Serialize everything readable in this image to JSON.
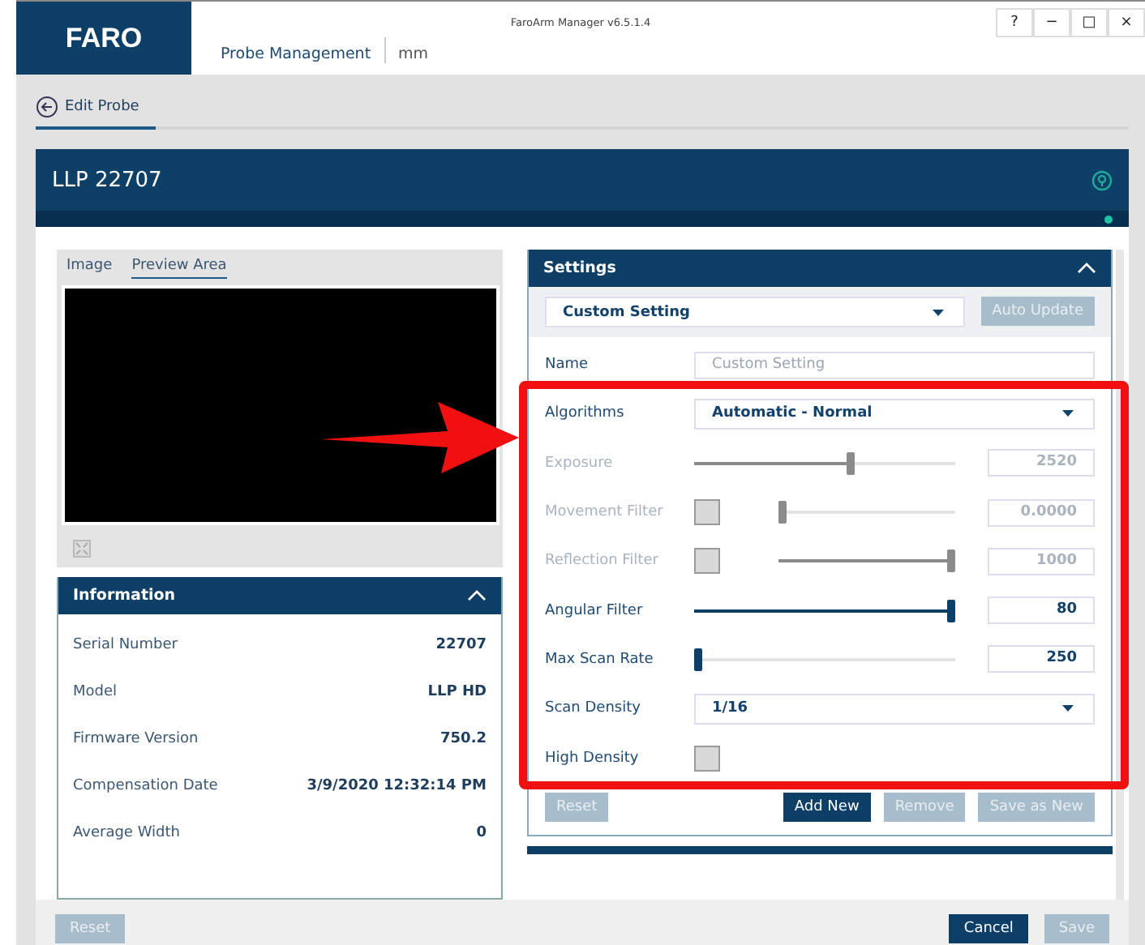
{
  "window": {
    "logo": "FARO",
    "title": "FaroArm Manager v6.5.1.4",
    "nav": "Probe Management",
    "units": "mm",
    "controls": [
      "?",
      "−",
      "□",
      "×"
    ]
  },
  "page_tab": {
    "label": "Edit Probe",
    "selected": true
  },
  "probe": {
    "name": "LLP 22707"
  },
  "preview": {
    "tabs": [
      {
        "label": "Image",
        "selected": false
      },
      {
        "label": "Preview Area",
        "selected": true
      }
    ]
  },
  "information": {
    "title": "Information",
    "rows": [
      {
        "label": "Serial Number",
        "value": "22707"
      },
      {
        "label": "Model",
        "value": "LLP HD"
      },
      {
        "label": "Firmware Version",
        "value": "750.2"
      },
      {
        "label": "Compensation Date",
        "value": "3/9/2020 12:32:14 PM"
      },
      {
        "label": "Average Width",
        "value": "0"
      }
    ]
  },
  "settings": {
    "title": "Settings",
    "preset": "Custom Setting",
    "auto_update": {
      "label": "Auto Update",
      "disabled": true
    },
    "rows": [
      {
        "kind": "text",
        "label": "Name",
        "placeholder": "Custom Setting",
        "disabled": false
      },
      {
        "kind": "select",
        "label": "Algorithms",
        "value": "Automatic - Normal",
        "disabled": false
      },
      {
        "kind": "slider",
        "label": "Exposure",
        "level": 0.6,
        "value": "2520",
        "disabled": true
      },
      {
        "kind": "check-slider",
        "label": "Movement Filter",
        "checked": false,
        "level": 0,
        "value": "0.0000",
        "disabled": true
      },
      {
        "kind": "check-slider",
        "label": "Reflection Filter",
        "checked": false,
        "level": 1,
        "value": "1000",
        "disabled": true
      },
      {
        "kind": "slider",
        "label": "Angular Filter",
        "level": 1,
        "value": "80",
        "disabled": false
      },
      {
        "kind": "slider",
        "label": "Max Scan Rate",
        "level": 0,
        "value": "250",
        "disabled": false
      },
      {
        "kind": "select",
        "label": "Scan Density",
        "value": "1/16",
        "disabled": false
      },
      {
        "kind": "checkbox",
        "label": "High Density",
        "checked": false,
        "disabled": false
      }
    ],
    "buttons": [
      {
        "label": "Reset",
        "disabled": true
      },
      {
        "label": "Add New",
        "disabled": false
      },
      {
        "label": "Remove",
        "disabled": true
      },
      {
        "label": "Save as New",
        "disabled": true
      }
    ]
  },
  "footer": {
    "buttons": [
      {
        "label": "Reset",
        "disabled": true
      },
      {
        "label": "Cancel",
        "disabled": false
      },
      {
        "label": "Save",
        "disabled": true
      }
    ]
  }
}
